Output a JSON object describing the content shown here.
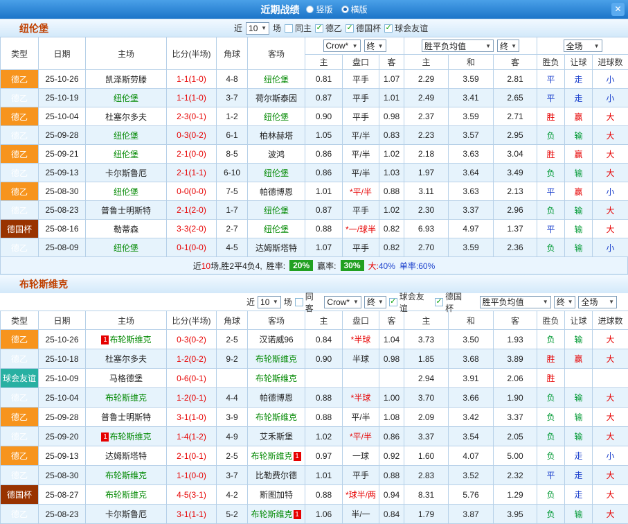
{
  "window": {
    "title": "近期战绩",
    "layout_options": [
      {
        "label": "竖版",
        "selected": false
      },
      {
        "label": "横版",
        "selected": true
      }
    ]
  },
  "icons": {
    "close": "✕",
    "dropdown_arrow": "▼",
    "check": "✓"
  },
  "colors": {
    "titlebar_top": "#4aa0e8",
    "titlebar_bottom": "#1b74c8",
    "close_bg": "#5aabf0",
    "border_blue": "#b6d0e8",
    "row_alt": "#e6f3fc",
    "type_league": "#f7941d",
    "type_cup": "#993300",
    "type_friendly": "#28b0a2",
    "team_green": "#008800",
    "team_title": "#c04000",
    "red": "#e60000",
    "blue": "#1a3fcc",
    "green": "#009933",
    "green_box": "#21a021",
    "bar_top": "#f2f9ff",
    "bar_bottom": "#d3e9fa",
    "summary_bg": "#eaf5fe"
  },
  "sections": [
    {
      "team": "纽伦堡",
      "filters": {
        "recent_prefix": "近",
        "recent_count": "10",
        "recent_suffix": "场",
        "same_venue": {
          "label": "同主",
          "checked": false
        },
        "comps": [
          {
            "label": "德乙",
            "checked": true
          },
          {
            "label": "德国杯",
            "checked": true
          },
          {
            "label": "球会友谊",
            "checked": true
          }
        ]
      },
      "dropdowns": {
        "bookmaker": "Crow*",
        "odds_time": "终",
        "avg": "胜平负均值",
        "avg_time": "终",
        "scope": "全场"
      },
      "header": {
        "cols": [
          "类型",
          "日期",
          "主场",
          "比分(半场)",
          "角球",
          "客场"
        ],
        "odds_sub": [
          "主",
          "盘口",
          "客"
        ],
        "avg_sub": [
          "主",
          "和",
          "客"
        ],
        "result_sub": [
          "胜负",
          "让球",
          "进球数"
        ]
      },
      "rows": [
        {
          "type": "德乙",
          "date": "25-10-26",
          "home": {
            "name": "凯泽斯劳滕"
          },
          "score": "1-1(1-0)",
          "corners": "4-8",
          "away": {
            "name": "纽伦堡",
            "self": true
          },
          "odds": [
            "0.81",
            "平手",
            "1.07"
          ],
          "avg": [
            "2.29",
            "3.59",
            "2.81"
          ],
          "results": [
            "平",
            "走",
            "小"
          ]
        },
        {
          "type": "德乙",
          "date": "25-10-19",
          "home": {
            "name": "纽伦堡",
            "self": true
          },
          "score": "1-1(1-0)",
          "corners": "3-7",
          "away": {
            "name": "荷尔斯泰因"
          },
          "odds": [
            "0.87",
            "平手",
            "1.01"
          ],
          "avg": [
            "2.49",
            "3.41",
            "2.65"
          ],
          "results": [
            "平",
            "走",
            "小"
          ]
        },
        {
          "type": "德乙",
          "date": "25-10-04",
          "home": {
            "name": "杜塞尔多夫"
          },
          "score": "2-3(0-1)",
          "corners": "1-2",
          "away": {
            "name": "纽伦堡",
            "self": true
          },
          "odds": [
            "0.90",
            "平手",
            "0.98"
          ],
          "avg": [
            "2.37",
            "3.59",
            "2.71"
          ],
          "results": [
            "胜",
            "赢",
            "大"
          ]
        },
        {
          "type": "德乙",
          "date": "25-09-28",
          "home": {
            "name": "纽伦堡",
            "self": true
          },
          "score": "0-3(0-2)",
          "corners": "6-1",
          "away": {
            "name": "柏林赫塔"
          },
          "odds": [
            "1.05",
            "平/半",
            "0.83"
          ],
          "avg": [
            "2.23",
            "3.57",
            "2.95"
          ],
          "results": [
            "负",
            "输",
            "大"
          ]
        },
        {
          "type": "德乙",
          "date": "25-09-21",
          "home": {
            "name": "纽伦堡",
            "self": true
          },
          "score": "2-1(0-0)",
          "corners": "8-5",
          "away": {
            "name": "波鸿"
          },
          "odds": [
            "0.86",
            "平/半",
            "1.02"
          ],
          "avg": [
            "2.18",
            "3.63",
            "3.04"
          ],
          "results": [
            "胜",
            "赢",
            "大"
          ]
        },
        {
          "type": "德乙",
          "date": "25-09-13",
          "home": {
            "name": "卡尔斯鲁厄"
          },
          "score": "2-1(1-1)",
          "corners": "6-10",
          "away": {
            "name": "纽伦堡",
            "self": true
          },
          "odds": [
            "0.86",
            "平/半",
            "1.03"
          ],
          "avg": [
            "1.97",
            "3.64",
            "3.49"
          ],
          "results": [
            "负",
            "输",
            "大"
          ]
        },
        {
          "type": "德乙",
          "date": "25-08-30",
          "home": {
            "name": "纽伦堡",
            "self": true
          },
          "score": "0-0(0-0)",
          "corners": "7-5",
          "away": {
            "name": "帕德博恩"
          },
          "odds": [
            "1.01",
            "*平/半",
            "0.88"
          ],
          "avg": [
            "3.11",
            "3.63",
            "2.13"
          ],
          "results": [
            "平",
            "赢",
            "小"
          ]
        },
        {
          "type": "德乙",
          "date": "25-08-23",
          "home": {
            "name": "普鲁士明斯特"
          },
          "score": "2-1(2-0)",
          "corners": "1-7",
          "away": {
            "name": "纽伦堡",
            "self": true
          },
          "odds": [
            "0.87",
            "平手",
            "1.02"
          ],
          "avg": [
            "2.30",
            "3.37",
            "2.96"
          ],
          "results": [
            "负",
            "输",
            "大"
          ]
        },
        {
          "type": "德国杯",
          "date": "25-08-16",
          "home": {
            "name": "勒蒂森"
          },
          "score": "3-3(2-0)",
          "corners": "2-7",
          "away": {
            "name": "纽伦堡",
            "self": true
          },
          "odds": [
            "0.88",
            "*一/球半",
            "0.82"
          ],
          "avg": [
            "6.93",
            "4.97",
            "1.37"
          ],
          "results": [
            "平",
            "输",
            "大"
          ]
        },
        {
          "type": "德乙",
          "date": "25-08-09",
          "home": {
            "name": "纽伦堡",
            "self": true
          },
          "score": "0-1(0-0)",
          "corners": "4-5",
          "away": {
            "name": "达姆斯塔特"
          },
          "odds": [
            "1.07",
            "平手",
            "0.82"
          ],
          "avg": [
            "2.70",
            "3.59",
            "2.36"
          ],
          "results": [
            "负",
            "输",
            "小"
          ]
        }
      ],
      "summary": {
        "prefix": "近",
        "count": "10",
        "tail": "场,胜2平4负4,",
        "win_rate_label": "胜率:",
        "win_rate": "20%",
        "cover_rate_label": "赢率:",
        "cover_rate": "30%",
        "big_label": "大:",
        "big_value": "40%",
        "odd_label": "单率:",
        "odd_value": "60%"
      }
    },
    {
      "team": "布轮斯维克",
      "filters": {
        "recent_prefix": "近",
        "recent_count": "10",
        "recent_suffix": "场",
        "same_venue": {
          "label": "同客",
          "checked": false
        },
        "comps": [
          {
            "label": "球会友谊",
            "checked": true
          },
          {
            "label": "德国杯",
            "checked": true
          }
        ]
      },
      "dropdowns": {
        "bookmaker": "Crow*",
        "odds_time": "终",
        "avg": "胜平负均值",
        "avg_time": "终",
        "scope": "全场"
      },
      "header": {
        "cols": [
          "类型",
          "日期",
          "主场",
          "比分(半场)",
          "角球",
          "客场"
        ],
        "odds_sub": [
          "主",
          "盘口",
          "客"
        ],
        "avg_sub": [
          "主",
          "和",
          "客"
        ],
        "result_sub": [
          "胜负",
          "让球",
          "进球数"
        ]
      },
      "rows": [
        {
          "type": "德乙",
          "date": "25-10-26",
          "home": {
            "name": "布轮斯维克",
            "self": true,
            "badge": "1",
            "badgePos": "before"
          },
          "score": "0-3(0-2)",
          "corners": "2-5",
          "away": {
            "name": "汉诺威96"
          },
          "odds": [
            "0.84",
            "*半球",
            "1.04"
          ],
          "avg": [
            "3.73",
            "3.50",
            "1.93"
          ],
          "results": [
            "负",
            "输",
            "大"
          ]
        },
        {
          "type": "德乙",
          "date": "25-10-18",
          "home": {
            "name": "杜塞尔多夫"
          },
          "score": "1-2(0-2)",
          "corners": "9-2",
          "away": {
            "name": "布轮斯维克",
            "self": true
          },
          "odds": [
            "0.90",
            "半球",
            "0.98"
          ],
          "avg": [
            "1.85",
            "3.68",
            "3.89"
          ],
          "results": [
            "胜",
            "赢",
            "大"
          ]
        },
        {
          "type": "球会友谊",
          "date": "25-10-09",
          "home": {
            "name": "马格德堡"
          },
          "score": "0-6(0-1)",
          "corners": "",
          "away": {
            "name": "布轮斯维克",
            "self": true
          },
          "odds": [
            "",
            "",
            ""
          ],
          "avg": [
            "2.94",
            "3.91",
            "2.06"
          ],
          "results": [
            "胜",
            "",
            ""
          ]
        },
        {
          "type": "德乙",
          "date": "25-10-04",
          "home": {
            "name": "布轮斯维克",
            "self": true
          },
          "score": "1-2(0-1)",
          "corners": "4-4",
          "away": {
            "name": "帕德博恩"
          },
          "odds": [
            "0.88",
            "*半球",
            "1.00"
          ],
          "avg": [
            "3.70",
            "3.66",
            "1.90"
          ],
          "results": [
            "负",
            "输",
            "大"
          ]
        },
        {
          "type": "德乙",
          "date": "25-09-28",
          "home": {
            "name": "普鲁士明斯特"
          },
          "score": "3-1(1-0)",
          "corners": "3-9",
          "away": {
            "name": "布轮斯维克",
            "self": true
          },
          "odds": [
            "0.88",
            "平/半",
            "1.08"
          ],
          "avg": [
            "2.09",
            "3.42",
            "3.37"
          ],
          "results": [
            "负",
            "输",
            "大"
          ]
        },
        {
          "type": "德乙",
          "date": "25-09-20",
          "home": {
            "name": "布轮斯维克",
            "self": true,
            "badge": "1",
            "badgePos": "before"
          },
          "score": "1-4(1-2)",
          "corners": "4-9",
          "away": {
            "name": "艾禾斯堡"
          },
          "odds": [
            "1.02",
            "*平/半",
            "0.86"
          ],
          "avg": [
            "3.37",
            "3.54",
            "2.05"
          ],
          "results": [
            "负",
            "输",
            "大"
          ]
        },
        {
          "type": "德乙",
          "date": "25-09-13",
          "home": {
            "name": "达姆斯塔特"
          },
          "score": "2-1(0-1)",
          "corners": "2-5",
          "away": {
            "name": "布轮斯维克",
            "self": true,
            "badge": "1",
            "badgePos": "after"
          },
          "odds": [
            "0.97",
            "一球",
            "0.92"
          ],
          "avg": [
            "1.60",
            "4.07",
            "5.00"
          ],
          "results": [
            "负",
            "走",
            "小"
          ]
        },
        {
          "type": "德乙",
          "date": "25-08-30",
          "home": {
            "name": "布轮斯维克",
            "self": true
          },
          "score": "1-1(0-0)",
          "corners": "3-7",
          "away": {
            "name": "比勒费尔德"
          },
          "odds": [
            "1.01",
            "平手",
            "0.88"
          ],
          "avg": [
            "2.83",
            "3.52",
            "2.32"
          ],
          "results": [
            "平",
            "走",
            "大"
          ]
        },
        {
          "type": "德国杯",
          "date": "25-08-27",
          "home": {
            "name": "布轮斯维克",
            "self": true
          },
          "score": "4-5(3-1)",
          "corners": "4-2",
          "away": {
            "name": "斯图加特"
          },
          "odds": [
            "0.88",
            "*球半/两",
            "0.94"
          ],
          "avg": [
            "8.31",
            "5.76",
            "1.29"
          ],
          "results": [
            "负",
            "走",
            "大"
          ]
        },
        {
          "type": "德乙",
          "date": "25-08-23",
          "home": {
            "name": "卡尔斯鲁厄"
          },
          "score": "3-1(1-1)",
          "corners": "5-2",
          "away": {
            "name": "布轮斯维克",
            "self": true,
            "badge": "1",
            "badgePos": "after"
          },
          "odds": [
            "1.06",
            "半/一",
            "0.84"
          ],
          "avg": [
            "1.79",
            "3.87",
            "3.95"
          ],
          "results": [
            "负",
            "输",
            "大"
          ]
        }
      ]
    }
  ]
}
